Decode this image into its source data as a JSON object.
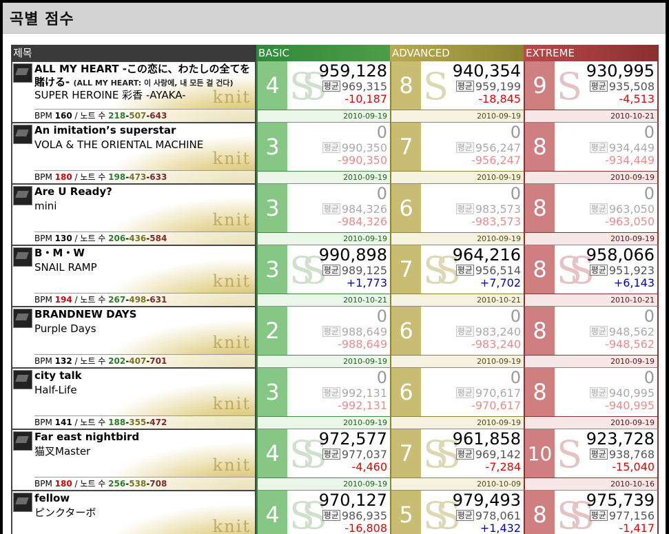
{
  "page": {
    "title": "곡별 점수"
  },
  "headers": {
    "title": "제목",
    "basic": "BASIC",
    "advanced": "ADVANCED",
    "extreme": "EXTREME"
  },
  "labels": {
    "bpm": "BPM",
    "notes": "노트 수",
    "avg": "평균",
    "watermark": "knit"
  },
  "rows": [
    {
      "title": "ALL MY HEART -この恋に、わたしの全てを賭ける-",
      "subtitle": "(ALL MY HEART: 이 사랑에, 내 모든 걸 건다)",
      "artist": "SUPER HEROINE 彩香 -AYAKA-",
      "bpm": "160",
      "notes_b": "218",
      "notes_a": "507",
      "notes_e": "643",
      "basic": {
        "level": "4",
        "score": "959,128",
        "avg": "969,315",
        "diff": "-10,187",
        "date": "2010-09-19",
        "rank": "SS"
      },
      "advanced": {
        "level": "8",
        "score": "940,354",
        "avg": "959,199",
        "diff": "-18,845",
        "date": "2010-09-19",
        "rank": "S"
      },
      "extreme": {
        "level": "9",
        "score": "930,995",
        "avg": "935,508",
        "diff": "-4,513",
        "date": "2010-10-21",
        "rank": "S"
      }
    },
    {
      "title": "An imitation’s superstar",
      "subtitle": "",
      "artist": "VOLA & THE ORIENTAL MACHINE",
      "bpm": "180",
      "notes_b": "198",
      "notes_a": "473",
      "notes_e": "633",
      "basic": {
        "level": "3",
        "score": "0",
        "avg": "990,350",
        "diff": "-990,350",
        "date": "2010-09-19",
        "rank": ""
      },
      "advanced": {
        "level": "7",
        "score": "0",
        "avg": "956,247",
        "diff": "-956,247",
        "date": "2010-09-19",
        "rank": ""
      },
      "extreme": {
        "level": "8",
        "score": "0",
        "avg": "934,449",
        "diff": "-934,449",
        "date": "2010-09-19",
        "rank": ""
      }
    },
    {
      "title": "Are U Ready?",
      "subtitle": "",
      "artist": "mini",
      "bpm": "130",
      "notes_b": "206",
      "notes_a": "436",
      "notes_e": "584",
      "basic": {
        "level": "3",
        "score": "0",
        "avg": "984,326",
        "diff": "-984,326",
        "date": "2010-09-19",
        "rank": ""
      },
      "advanced": {
        "level": "6",
        "score": "0",
        "avg": "983,573",
        "diff": "-983,573",
        "date": "2010-09-19",
        "rank": ""
      },
      "extreme": {
        "level": "8",
        "score": "0",
        "avg": "963,050",
        "diff": "-963,050",
        "date": "2010-09-19",
        "rank": ""
      }
    },
    {
      "title": "B・M・W",
      "subtitle": "",
      "artist": "SNAIL RAMP",
      "bpm": "194",
      "notes_b": "267",
      "notes_a": "498",
      "notes_e": "631",
      "basic": {
        "level": "3",
        "score": "990,898",
        "avg": "989,125",
        "diff": "+1,773",
        "date": "2010-10-21",
        "rank": "SS"
      },
      "advanced": {
        "level": "7",
        "score": "964,216",
        "avg": "956,514",
        "diff": "+7,702",
        "date": "2010-10-21",
        "rank": "SS"
      },
      "extreme": {
        "level": "8",
        "score": "958,066",
        "avg": "951,923",
        "diff": "+6,143",
        "date": "2010-10-21",
        "rank": "SS"
      }
    },
    {
      "title": "BRANDNEW DAYS",
      "subtitle": "",
      "artist": "Purple Days",
      "bpm": "132",
      "notes_b": "202",
      "notes_a": "407",
      "notes_e": "701",
      "basic": {
        "level": "2",
        "score": "0",
        "avg": "988,649",
        "diff": "-988,649",
        "date": "2010-09-19",
        "rank": ""
      },
      "advanced": {
        "level": "6",
        "score": "0",
        "avg": "983,240",
        "diff": "-983,240",
        "date": "2010-09-19",
        "rank": ""
      },
      "extreme": {
        "level": "8",
        "score": "0",
        "avg": "948,562",
        "diff": "-948,562",
        "date": "2010-09-19",
        "rank": ""
      }
    },
    {
      "title": "city talk",
      "subtitle": "",
      "artist": "Half-Life",
      "bpm": "141",
      "notes_b": "188",
      "notes_a": "355",
      "notes_e": "472",
      "basic": {
        "level": "3",
        "score": "0",
        "avg": "992,131",
        "diff": "-992,131",
        "date": "2010-09-19",
        "rank": ""
      },
      "advanced": {
        "level": "6",
        "score": "0",
        "avg": "970,617",
        "diff": "-970,617",
        "date": "2010-09-19",
        "rank": ""
      },
      "extreme": {
        "level": "8",
        "score": "0",
        "avg": "940,995",
        "diff": "-940,995",
        "date": "2010-09-19",
        "rank": ""
      }
    },
    {
      "title": "Far east nightbird",
      "subtitle": "",
      "artist": "猫叉Master",
      "bpm": "180",
      "notes_b": "256",
      "notes_a": "538",
      "notes_e": "708",
      "basic": {
        "level": "4",
        "score": "972,577",
        "avg": "977,037",
        "diff": "-4,460",
        "date": "2010-09-19",
        "rank": "SS"
      },
      "advanced": {
        "level": "7",
        "score": "961,858",
        "avg": "969,142",
        "diff": "-7,284",
        "date": "2010-10-09",
        "rank": "SS"
      },
      "extreme": {
        "level": "10",
        "score": "923,728",
        "avg": "938,768",
        "diff": "-15,040",
        "date": "2010-10-16",
        "rank": "S"
      }
    },
    {
      "title": "fellow",
      "subtitle": "",
      "artist": "ピンクターボ",
      "bpm": "",
      "notes_b": "",
      "notes_a": "",
      "notes_e": "",
      "basic": {
        "level": "4",
        "score": "970,127",
        "avg": "986,935",
        "diff": "-16,808",
        "date": "",
        "rank": "SS"
      },
      "advanced": {
        "level": "5",
        "score": "979,493",
        "avg": "978,061",
        "diff": "+1,432",
        "date": "",
        "rank": "SS"
      },
      "extreme": {
        "level": "8",
        "score": "975,739",
        "avg": "977,156",
        "diff": "-1,417",
        "date": "",
        "rank": "SS"
      }
    }
  ]
}
